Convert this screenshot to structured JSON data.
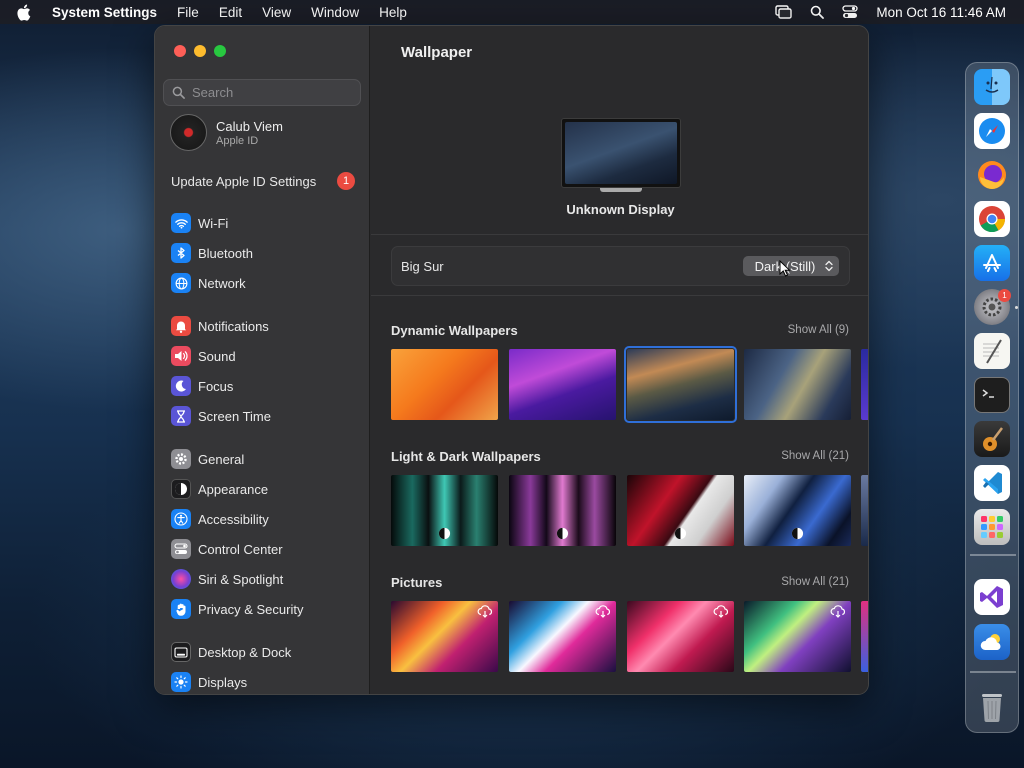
{
  "menubar": {
    "app_name": "System Settings",
    "items": [
      "File",
      "Edit",
      "View",
      "Window",
      "Help"
    ],
    "datetime": "Mon Oct 16  11:46 AM"
  },
  "sidebar": {
    "search_placeholder": "Search",
    "profile": {
      "name": "Calub Viem",
      "subtitle": "Apple ID"
    },
    "update": {
      "label": "Update Apple ID Settings",
      "badge": "1"
    },
    "items": [
      {
        "label": "Wi-Fi",
        "icon": "wifi-icon",
        "color": "#1a82f4"
      },
      {
        "label": "Bluetooth",
        "icon": "bluetooth-icon",
        "color": "#1a82f4"
      },
      {
        "label": "Network",
        "icon": "globe-icon",
        "color": "#1a82f4"
      },
      {
        "label": "Notifications",
        "icon": "bell-icon",
        "color": "#eb4b41"
      },
      {
        "label": "Sound",
        "icon": "speaker-icon",
        "color": "#eb4b5f"
      },
      {
        "label": "Focus",
        "icon": "moon-icon",
        "color": "#5a55d6"
      },
      {
        "label": "Screen Time",
        "icon": "hourglass-icon",
        "color": "#5a55d6"
      },
      {
        "label": "General",
        "icon": "gear-icon",
        "color": "#8e8e93"
      },
      {
        "label": "Appearance",
        "icon": "appearance-icon",
        "color": "#1c1c1e"
      },
      {
        "label": "Accessibility",
        "icon": "accessibility-icon",
        "color": "#1a82f4"
      },
      {
        "label": "Control Center",
        "icon": "toggles-icon",
        "color": "#8e8e93"
      },
      {
        "label": "Siri & Spotlight",
        "icon": "siri-icon",
        "color": "#7a3fd1"
      },
      {
        "label": "Privacy & Security",
        "icon": "hand-icon",
        "color": "#1a82f4"
      },
      {
        "label": "Desktop & Dock",
        "icon": "dock-icon",
        "color": "#1c1c1e"
      },
      {
        "label": "Displays",
        "icon": "sun-icon",
        "color": "#1a82f4"
      }
    ]
  },
  "content": {
    "title": "Wallpaper",
    "display_name": "Unknown Display",
    "current_wallpaper": "Big Sur",
    "mode_value": "Dark (Still)",
    "sections": [
      {
        "title": "Dynamic Wallpapers",
        "more": "Show All (9)"
      },
      {
        "title": "Light & Dark Wallpapers",
        "more": "Show All (21)"
      },
      {
        "title": "Pictures",
        "more": "Show All (21)"
      }
    ]
  },
  "dock": {
    "apps": [
      "Finder",
      "Safari",
      "Firefox",
      "Chrome",
      "App Store",
      "System Settings",
      "TextEdit",
      "Terminal",
      "GarageBand",
      "Visual Studio Code",
      "Launchpad",
      "Visual Studio",
      "Weather",
      "Trash"
    ],
    "settings_badge": "1"
  },
  "colors": {
    "accent": "#2f6fd8",
    "badge": "#eb4b41"
  }
}
